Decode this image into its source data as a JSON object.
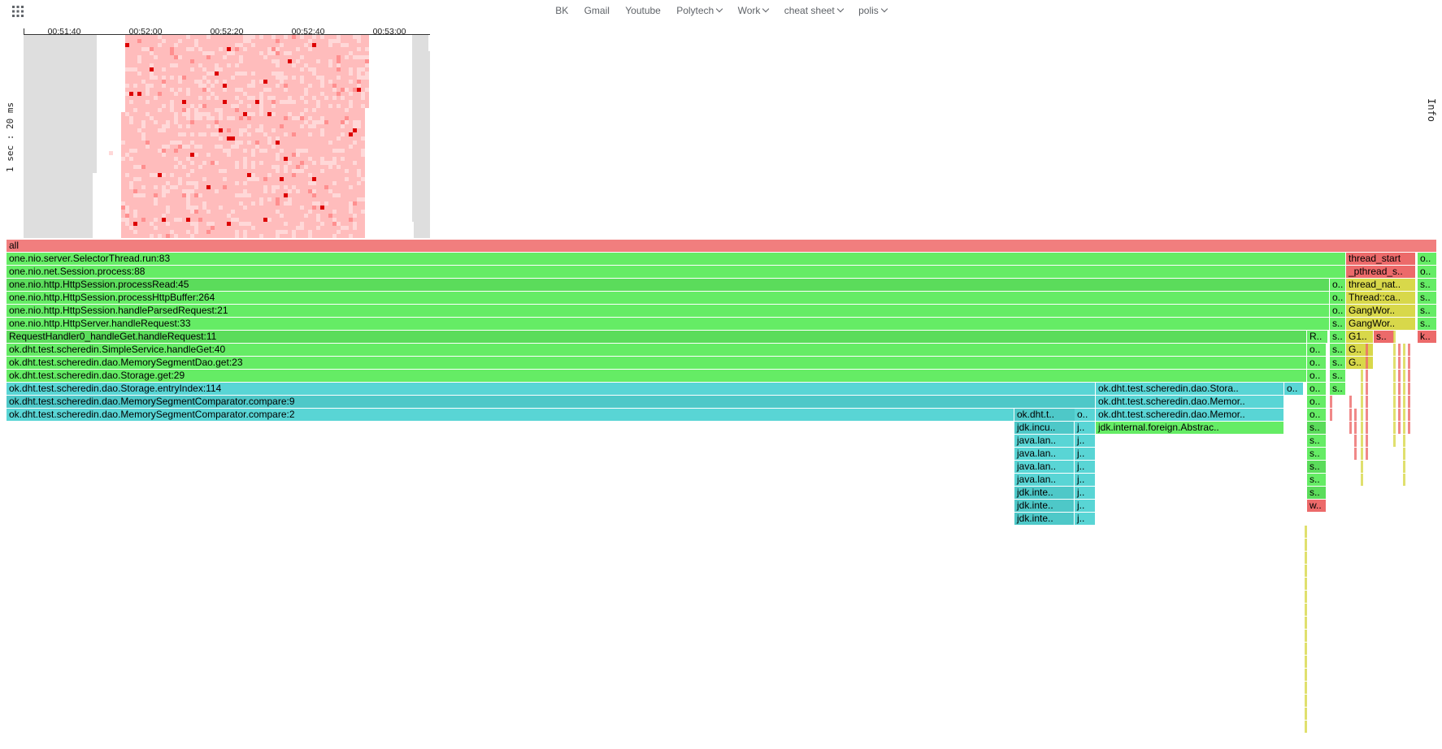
{
  "bookmarks": {
    "apps_icon": "apps-grid-icon",
    "items": [
      {
        "label": "BK",
        "dropdown": false
      },
      {
        "label": "Gmail",
        "dropdown": false
      },
      {
        "label": "Youtube",
        "dropdown": false
      },
      {
        "label": "Polytech",
        "dropdown": true
      },
      {
        "label": "Work",
        "dropdown": true
      },
      {
        "label": "cheat sheet",
        "dropdown": true
      },
      {
        "label": "polis",
        "dropdown": true
      }
    ]
  },
  "heatmap": {
    "y_axis_label": "1 sec : 20 ms",
    "time_ticks": [
      "00:51:40",
      "00:52:00",
      "00:52:20",
      "00:52:40",
      "00:53:00"
    ],
    "colors": {
      "idle": "#dedede",
      "base": "#ffbcbc",
      "light": "#ffd8d8",
      "hot": "#dd0000",
      "warm": "#ff8f8f"
    }
  },
  "info_label": "Info",
  "flame_colors": {
    "root": "#f17e7e",
    "green": "#65ec65",
    "green2": "#5bdc5b",
    "cyan": "#59d5d5",
    "cyan2": "#4ec8c8",
    "yellow": "#d8d84a",
    "red": "#ec6a6a"
  },
  "flame": [
    {
      "level": 0,
      "start": 0,
      "width": 1760,
      "color": "root",
      "label": "all"
    },
    {
      "level": 1,
      "start": 0,
      "width": 1648,
      "color": "green",
      "label": "one.nio.server.SelectorThread.run:83"
    },
    {
      "level": 2,
      "start": 0,
      "width": 1648,
      "color": "green",
      "label": "one.nio.net.Session.process:88"
    },
    {
      "level": 3,
      "start": 0,
      "width": 1628,
      "color": "green2",
      "label": "one.nio.http.HttpSession.processRead:45"
    },
    {
      "level": 3,
      "start": 1628,
      "width": 20,
      "color": "green",
      "label": "o.."
    },
    {
      "level": 4,
      "start": 0,
      "width": 1628,
      "color": "green",
      "label": "one.nio.http.HttpSession.processHttpBuffer:264"
    },
    {
      "level": 4,
      "start": 1628,
      "width": 20,
      "color": "green",
      "label": "o.."
    },
    {
      "level": 5,
      "start": 0,
      "width": 1628,
      "color": "green",
      "label": "one.nio.http.HttpSession.handleParsedRequest:21"
    },
    {
      "level": 5,
      "start": 1628,
      "width": 20,
      "color": "green",
      "label": "o.."
    },
    {
      "level": 6,
      "start": 0,
      "width": 1628,
      "color": "green",
      "label": "one.nio.http.HttpServer.handleRequest:33"
    },
    {
      "level": 6,
      "start": 1628,
      "width": 20,
      "color": "green",
      "label": "s.."
    },
    {
      "level": 7,
      "start": 0,
      "width": 1600,
      "color": "green2",
      "label": "RequestHandler0_handleGet.handleRequest:11"
    },
    {
      "level": 7,
      "start": 1600,
      "width": 26,
      "color": "green",
      "label": "R.."
    },
    {
      "level": 7,
      "start": 1628,
      "width": 20,
      "color": "green",
      "label": "s.."
    },
    {
      "level": 8,
      "start": 0,
      "width": 1600,
      "color": "green",
      "label": "ok.dht.test.scheredin.SimpleService.handleGet:40"
    },
    {
      "level": 8,
      "start": 1600,
      "width": 24,
      "color": "green",
      "label": "o.."
    },
    {
      "level": 8,
      "start": 1628,
      "width": 20,
      "color": "green",
      "label": "s.."
    },
    {
      "level": 9,
      "start": 0,
      "width": 1600,
      "color": "green",
      "label": "ok.dht.test.scheredin.dao.MemorySegmentDao.get:23"
    },
    {
      "level": 9,
      "start": 1600,
      "width": 24,
      "color": "green",
      "label": "o.."
    },
    {
      "level": 9,
      "start": 1628,
      "width": 20,
      "color": "green",
      "label": "s.."
    },
    {
      "level": 10,
      "start": 0,
      "width": 1600,
      "color": "green",
      "label": "ok.dht.test.scheredin.dao.Storage.get:29"
    },
    {
      "level": 10,
      "start": 1600,
      "width": 24,
      "color": "green",
      "label": "o.."
    },
    {
      "level": 10,
      "start": 1628,
      "width": 20,
      "color": "green",
      "label": "s.."
    },
    {
      "level": 11,
      "start": 0,
      "width": 1340,
      "color": "cyan",
      "label": "ok.dht.test.scheredin.dao.Storage.entryIndex:114"
    },
    {
      "level": 11,
      "start": 1340,
      "width": 232,
      "color": "cyan",
      "label": "ok.dht.test.scheredin.dao.Stora.."
    },
    {
      "level": 11,
      "start": 1572,
      "width": 24,
      "color": "cyan",
      "label": "o.."
    },
    {
      "level": 11,
      "start": 1600,
      "width": 24,
      "color": "green",
      "label": "o.."
    },
    {
      "level": 11,
      "start": 1628,
      "width": 20,
      "color": "green",
      "label": "s.."
    },
    {
      "level": 12,
      "start": 0,
      "width": 1340,
      "color": "cyan2",
      "label": "ok.dht.test.scheredin.dao.MemorySegmentComparator.compare:9"
    },
    {
      "level": 12,
      "start": 1340,
      "width": 232,
      "color": "cyan",
      "label": "ok.dht.test.scheredin.dao.Memor.."
    },
    {
      "level": 12,
      "start": 1600,
      "width": 24,
      "color": "green",
      "label": "o.."
    },
    {
      "level": 13,
      "start": 0,
      "width": 1240,
      "color": "cyan",
      "label": "ok.dht.test.scheredin.dao.MemorySegmentComparator.compare:2"
    },
    {
      "level": 13,
      "start": 1240,
      "width": 100,
      "color": "cyan2",
      "label": "ok.dht.t.."
    },
    {
      "level": 13,
      "start": 1314,
      "width": 26,
      "color": "cyan",
      "label": "o.."
    },
    {
      "level": 13,
      "start": 1340,
      "width": 232,
      "color": "cyan",
      "label": "ok.dht.test.scheredin.dao.Memor.."
    },
    {
      "level": 13,
      "start": 1600,
      "width": 24,
      "color": "green",
      "label": "o.."
    },
    {
      "level": 14,
      "start": 1240,
      "width": 74,
      "color": "cyan2",
      "label": "jdk.incu.."
    },
    {
      "level": 14,
      "start": 1314,
      "width": 26,
      "color": "cyan",
      "label": "j.."
    },
    {
      "level": 14,
      "start": 1340,
      "width": 232,
      "color": "green",
      "label": "jdk.internal.foreign.Abstrac.."
    },
    {
      "level": 14,
      "start": 1600,
      "width": 24,
      "color": "green2",
      "label": "s.."
    },
    {
      "level": 15,
      "start": 1240,
      "width": 74,
      "color": "cyan",
      "label": "java.lan.."
    },
    {
      "level": 15,
      "start": 1314,
      "width": 26,
      "color": "cyan",
      "label": "j.."
    },
    {
      "level": 15,
      "start": 1600,
      "width": 24,
      "color": "green",
      "label": "s.."
    },
    {
      "level": 16,
      "start": 1240,
      "width": 74,
      "color": "cyan",
      "label": "java.lan.."
    },
    {
      "level": 16,
      "start": 1314,
      "width": 26,
      "color": "cyan",
      "label": "j.."
    },
    {
      "level": 16,
      "start": 1600,
      "width": 24,
      "color": "green",
      "label": "s.."
    },
    {
      "level": 17,
      "start": 1240,
      "width": 74,
      "color": "cyan",
      "label": "java.lan.."
    },
    {
      "level": 17,
      "start": 1314,
      "width": 26,
      "color": "cyan",
      "label": "j.."
    },
    {
      "level": 17,
      "start": 1600,
      "width": 24,
      "color": "green2",
      "label": "s.."
    },
    {
      "level": 18,
      "start": 1240,
      "width": 74,
      "color": "cyan",
      "label": "java.lan.."
    },
    {
      "level": 18,
      "start": 1314,
      "width": 26,
      "color": "cyan",
      "label": "j.."
    },
    {
      "level": 18,
      "start": 1600,
      "width": 24,
      "color": "green",
      "label": "s.."
    },
    {
      "level": 19,
      "start": 1240,
      "width": 74,
      "color": "cyan2",
      "label": "jdk.inte.."
    },
    {
      "level": 19,
      "start": 1314,
      "width": 26,
      "color": "cyan",
      "label": "j.."
    },
    {
      "level": 19,
      "start": 1600,
      "width": 24,
      "color": "green2",
      "label": "s.."
    },
    {
      "level": 20,
      "start": 1240,
      "width": 74,
      "color": "cyan2",
      "label": "jdk.inte.."
    },
    {
      "level": 20,
      "start": 1314,
      "width": 26,
      "color": "cyan",
      "label": "j.."
    },
    {
      "level": 20,
      "start": 1600,
      "width": 24,
      "color": "red",
      "label": "w.."
    },
    {
      "level": 21,
      "start": 1240,
      "width": 74,
      "color": "cyan2",
      "label": "jdk.inte.."
    },
    {
      "level": 21,
      "start": 1314,
      "width": 26,
      "color": "cyan",
      "label": "j.."
    },
    {
      "level": 1,
      "start": 1648,
      "width": 86,
      "color": "red",
      "label": "thread_start"
    },
    {
      "level": 1,
      "start": 1736,
      "width": 24,
      "color": "green",
      "label": "o.."
    },
    {
      "level": 2,
      "start": 1648,
      "width": 86,
      "color": "red",
      "label": "_pthread_s.."
    },
    {
      "level": 2,
      "start": 1736,
      "width": 24,
      "color": "green",
      "label": "o.."
    },
    {
      "level": 3,
      "start": 1648,
      "width": 86,
      "color": "yellow",
      "label": "thread_nat.."
    },
    {
      "level": 3,
      "start": 1736,
      "width": 24,
      "color": "green",
      "label": "s.."
    },
    {
      "level": 4,
      "start": 1648,
      "width": 86,
      "color": "yellow",
      "label": "Thread::ca.."
    },
    {
      "level": 4,
      "start": 1736,
      "width": 24,
      "color": "green",
      "label": "s.."
    },
    {
      "level": 5,
      "start": 1648,
      "width": 86,
      "color": "yellow",
      "label": "GangWor.."
    },
    {
      "level": 5,
      "start": 1736,
      "width": 24,
      "color": "green",
      "label": "s.."
    },
    {
      "level": 6,
      "start": 1648,
      "width": 86,
      "color": "yellow",
      "label": "GangWor.."
    },
    {
      "level": 6,
      "start": 1736,
      "width": 24,
      "color": "green",
      "label": "s.."
    },
    {
      "level": 7,
      "start": 1648,
      "width": 34,
      "color": "yellow",
      "label": "G1.."
    },
    {
      "level": 7,
      "start": 1682,
      "width": 26,
      "color": "red",
      "label": "s.."
    },
    {
      "level": 7,
      "start": 1736,
      "width": 24,
      "color": "red",
      "label": "k.."
    },
    {
      "level": 8,
      "start": 1648,
      "width": 34,
      "color": "yellow",
      "label": "G.."
    },
    {
      "level": 9,
      "start": 1648,
      "width": 34,
      "color": "yellow",
      "label": "G.."
    }
  ]
}
